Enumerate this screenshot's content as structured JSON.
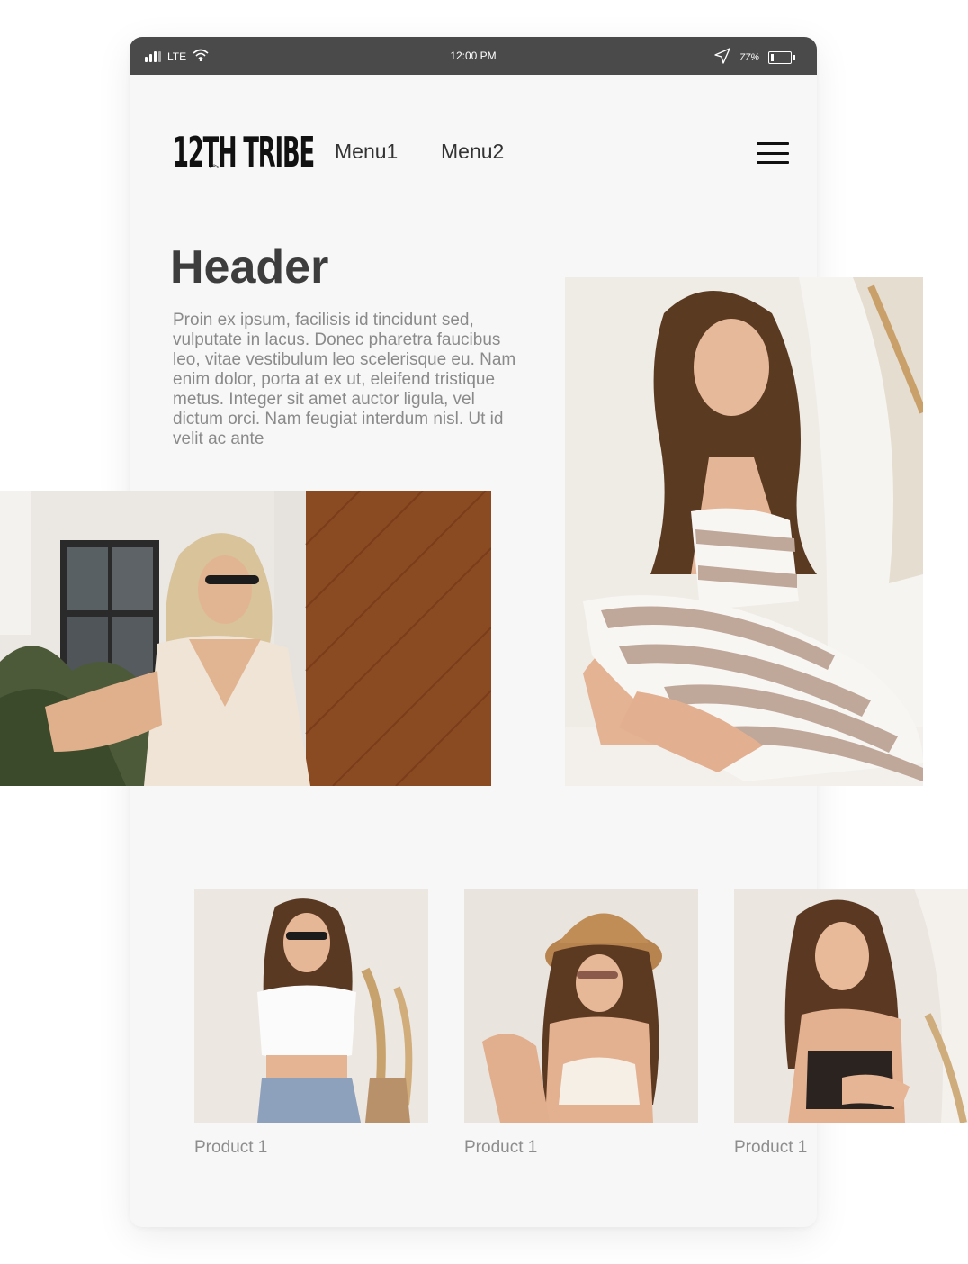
{
  "status_bar": {
    "carrier": "LTE",
    "time": "12:00 PM",
    "battery": "77%"
  },
  "header": {
    "logo": "12TH TRIBE",
    "menu": [
      "Menu1",
      "Menu2"
    ]
  },
  "hero": {
    "title": "Header",
    "body": "Proin ex ipsum, facilisis id tincidunt sed, vulputate in lacus. Donec pharetra faucibus leo, vitae vestibulum leo scelerisque eu. Nam enim dolor, porta at ex ut, eleifend tristique metus. Integer sit amet auctor ligula, vel dictum orci. Nam feugiat interdum nisl. Ut id velit ac ante"
  },
  "products": [
    {
      "label": "Product 1"
    },
    {
      "label": "Product 1"
    },
    {
      "label": "Product 1"
    }
  ],
  "icons": [
    "signal-icon",
    "wifi-icon",
    "location-arrow-icon",
    "battery-icon",
    "hamburger-menu-icon"
  ],
  "colors": {
    "status_bar": "#4a4a4a",
    "screen_background": "#f7f7f7",
    "title": "#3d3d3d",
    "body_text": "#8a8a8a",
    "wood_panel": "#8a4a22"
  }
}
